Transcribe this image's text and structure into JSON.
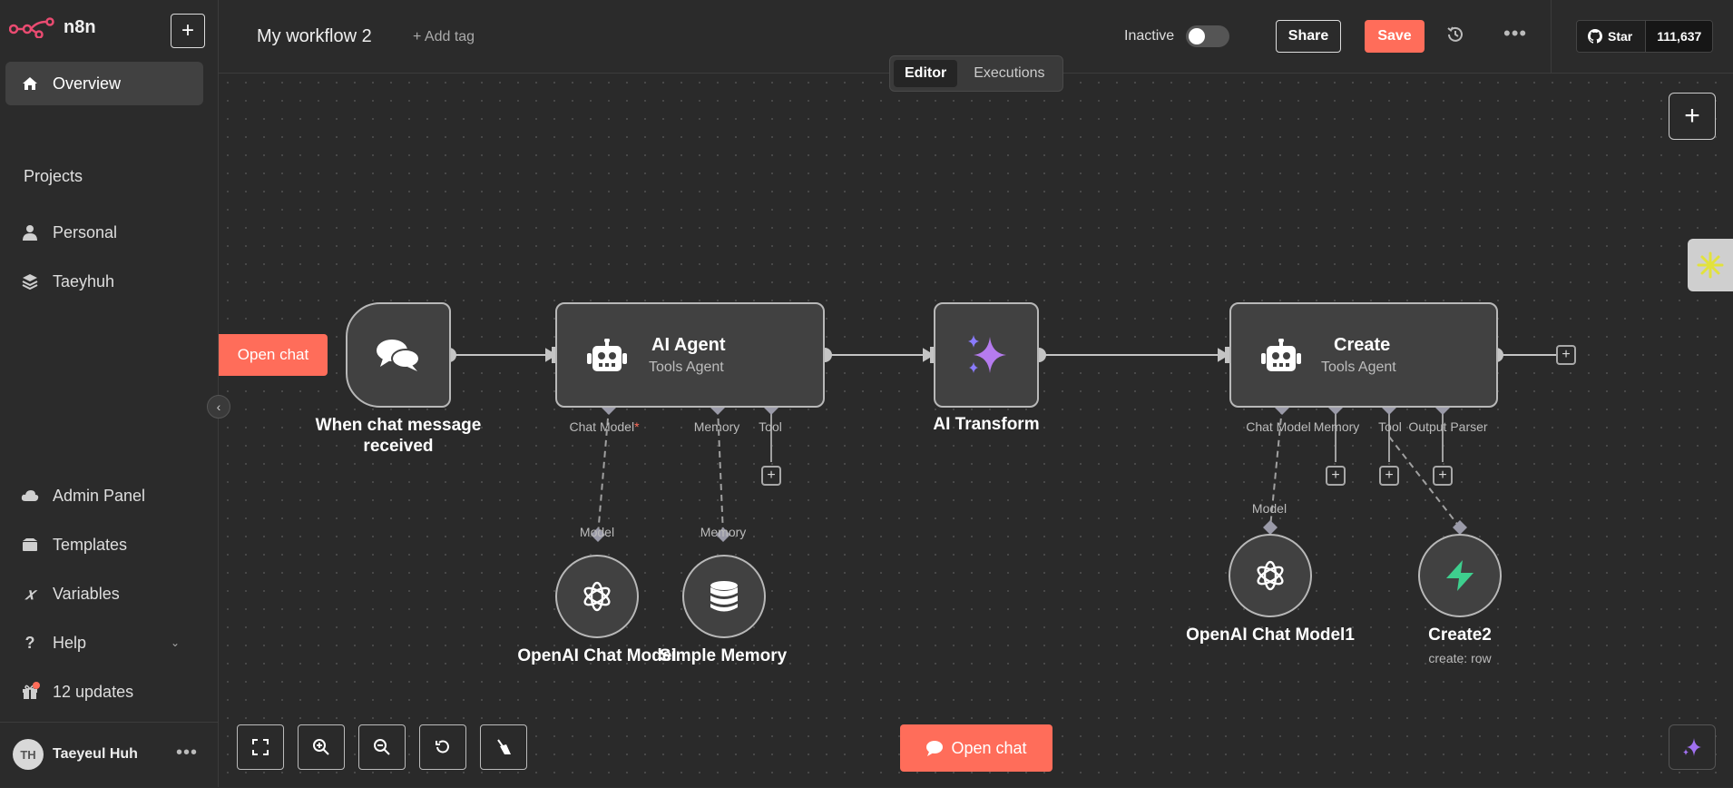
{
  "app": {
    "logo_text": "n8n"
  },
  "sidebar": {
    "overview": "Overview",
    "projects_label": "Projects",
    "projects": [
      {
        "label": "Personal"
      },
      {
        "label": "Taeyhuh"
      }
    ],
    "bottom_items": [
      {
        "label": "Admin Panel"
      },
      {
        "label": "Templates"
      },
      {
        "label": "Variables"
      },
      {
        "label": "Help"
      },
      {
        "label": "12 updates"
      }
    ],
    "user": {
      "initials": "TH",
      "name": "Taeyeul Huh"
    }
  },
  "topbar": {
    "workflow_name": "My workflow 2",
    "add_tag": "+ Add tag",
    "status": "Inactive",
    "share": "Share",
    "save": "Save",
    "github_star": "Star",
    "github_count": "111,637",
    "tabs": [
      {
        "label": "Editor",
        "active": true
      },
      {
        "label": "Executions",
        "active": false
      }
    ]
  },
  "canvas": {
    "open_chat_tag": "Open chat",
    "nodes": {
      "trigger": {
        "label_line1": "When chat message",
        "label_line2": "received"
      },
      "agent": {
        "title": "AI Agent",
        "subtitle": "Tools Agent",
        "ports": [
          "Chat Model",
          "Memory",
          "Tool"
        ],
        "required_mark": "*"
      },
      "transform": {
        "label": "AI Transform"
      },
      "create": {
        "title": "Create",
        "subtitle": "Tools Agent",
        "ports": [
          "Chat Model",
          "Memory",
          "Tool",
          "Output Parser"
        ]
      },
      "openai1": {
        "label": "OpenAI Chat Model",
        "port": "Model"
      },
      "memory": {
        "label": "Simple Memory",
        "port": "Memory"
      },
      "openai2": {
        "label": "OpenAI Chat Model1",
        "port": "Model"
      },
      "create2": {
        "label": "Create2",
        "subtitle": "create: row"
      }
    },
    "bottom_open_chat": "Open chat"
  },
  "colors": {
    "accent": "#ff6d5a",
    "canvas_bg": "#2a2a2a",
    "sidebar_bg": "#2b2b2b"
  }
}
